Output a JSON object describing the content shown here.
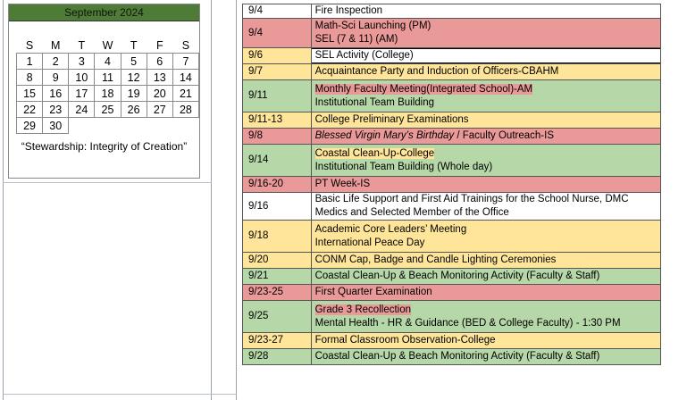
{
  "calendar": {
    "month": "September 2024",
    "weekdays": [
      "S",
      "M",
      "T",
      "W",
      "T",
      "F",
      "S"
    ],
    "weeks": [
      [
        "1",
        "2",
        "3",
        "4",
        "5",
        "6",
        "7"
      ],
      [
        "8",
        "9",
        "10",
        "11",
        "12",
        "13",
        "14"
      ],
      [
        "15",
        "16",
        "17",
        "18",
        "19",
        "20",
        "21"
      ],
      [
        "22",
        "23",
        "24",
        "25",
        "26",
        "27",
        "28"
      ],
      [
        "29",
        "30",
        "",
        "",
        "",
        "",
        ""
      ]
    ],
    "theme": "“Stewardship: Integrity of Creation”",
    "colors": {
      "header": "#4e7c36"
    }
  },
  "schedule": {
    "colors": {
      "red": "#ea9999",
      "yellow": "#ffe599",
      "green": "#b6d7a8",
      "white": "#ffffff"
    },
    "rows": [
      {
        "date": "9/4",
        "color": "white",
        "lines": [
          {
            "text": "Fire Inspection"
          }
        ]
      },
      {
        "date": "9/4",
        "color": "red",
        "lines": [
          {
            "text": "Math-Sci Launching (PM)"
          },
          {
            "text": "SEL (7 & 11) (AM)"
          }
        ]
      },
      {
        "date": "9/6",
        "color": "yellow",
        "lines": [
          {
            "text": "SEL Activity  (College)",
            "box": true
          }
        ]
      },
      {
        "date": "9/7",
        "color": "yellow",
        "lines": [
          {
            "text": "Acquaintance Party and Induction of Officers-CBAHM"
          }
        ]
      },
      {
        "date": "9/11",
        "color": "green",
        "lines": [
          {
            "text": "Monthly Faculty Meeting(Integrated School)-AM",
            "hl": "red"
          },
          {
            "text": "Institutional Team Building"
          }
        ]
      },
      {
        "date": "9/11-13",
        "color": "yellow",
        "lines": [
          {
            "text": "College Preliminary Examinations"
          }
        ]
      },
      {
        "date": "9/8",
        "color": "red",
        "lines": [
          {
            "italic": "Blessed Virgin Mary’s Birthday",
            "text": " / Faculty Outreach-IS"
          }
        ]
      },
      {
        "date": "9/14",
        "color": "green",
        "lines": [
          {
            "text": "Coastal Clean-Up-College",
            "hl": "yellow"
          },
          {
            "text": "Institutional Team Building (Whole day)"
          }
        ]
      },
      {
        "date": "9/16-20",
        "color": "red",
        "lines": [
          {
            "text": "PT Week-IS"
          }
        ]
      },
      {
        "date": "9/16",
        "color": "white",
        "lines": [
          {
            "text": "Basic Life Support and First Aid Trainings for the School Nurse, DMC"
          },
          {
            "text": "Medics and Selected Member of the Office"
          }
        ]
      },
      {
        "date": "9/18",
        "color": "yellow",
        "lines": [
          {
            "text": "Academic Core Leaders’ Meeting"
          },
          {
            "text": "International Peace Day"
          }
        ]
      },
      {
        "date": "9/20",
        "color": "yellow",
        "lines": [
          {
            "text": "CONM Cap, Badge and Candle Lighting Ceremonies"
          }
        ]
      },
      {
        "date": "9/21",
        "color": "green",
        "lines": [
          {
            "text": "Coastal Clean-Up & Beach Monitoring Activity (Faculty & Staff)"
          }
        ]
      },
      {
        "date": "9/23-25",
        "color": "red",
        "lines": [
          {
            "text": "First Quarter Examination"
          }
        ]
      },
      {
        "date": "9/25",
        "color": "green",
        "lines": [
          {
            "text": "Grade 3 Recollection",
            "hl": "red"
          },
          {
            "text": "Mental Health - HR & Guidance (BED & College Faculty) - 1:30 PM"
          }
        ]
      },
      {
        "date": "9/23-27",
        "color": "yellow",
        "lines": [
          {
            "text": "Formal Classroom Observation-College"
          }
        ]
      },
      {
        "date": "9/28",
        "color": "green",
        "lines": [
          {
            "text": "Coastal Clean-Up & Beach Monitoring Activity (Faculty & Staff)"
          }
        ]
      }
    ]
  }
}
